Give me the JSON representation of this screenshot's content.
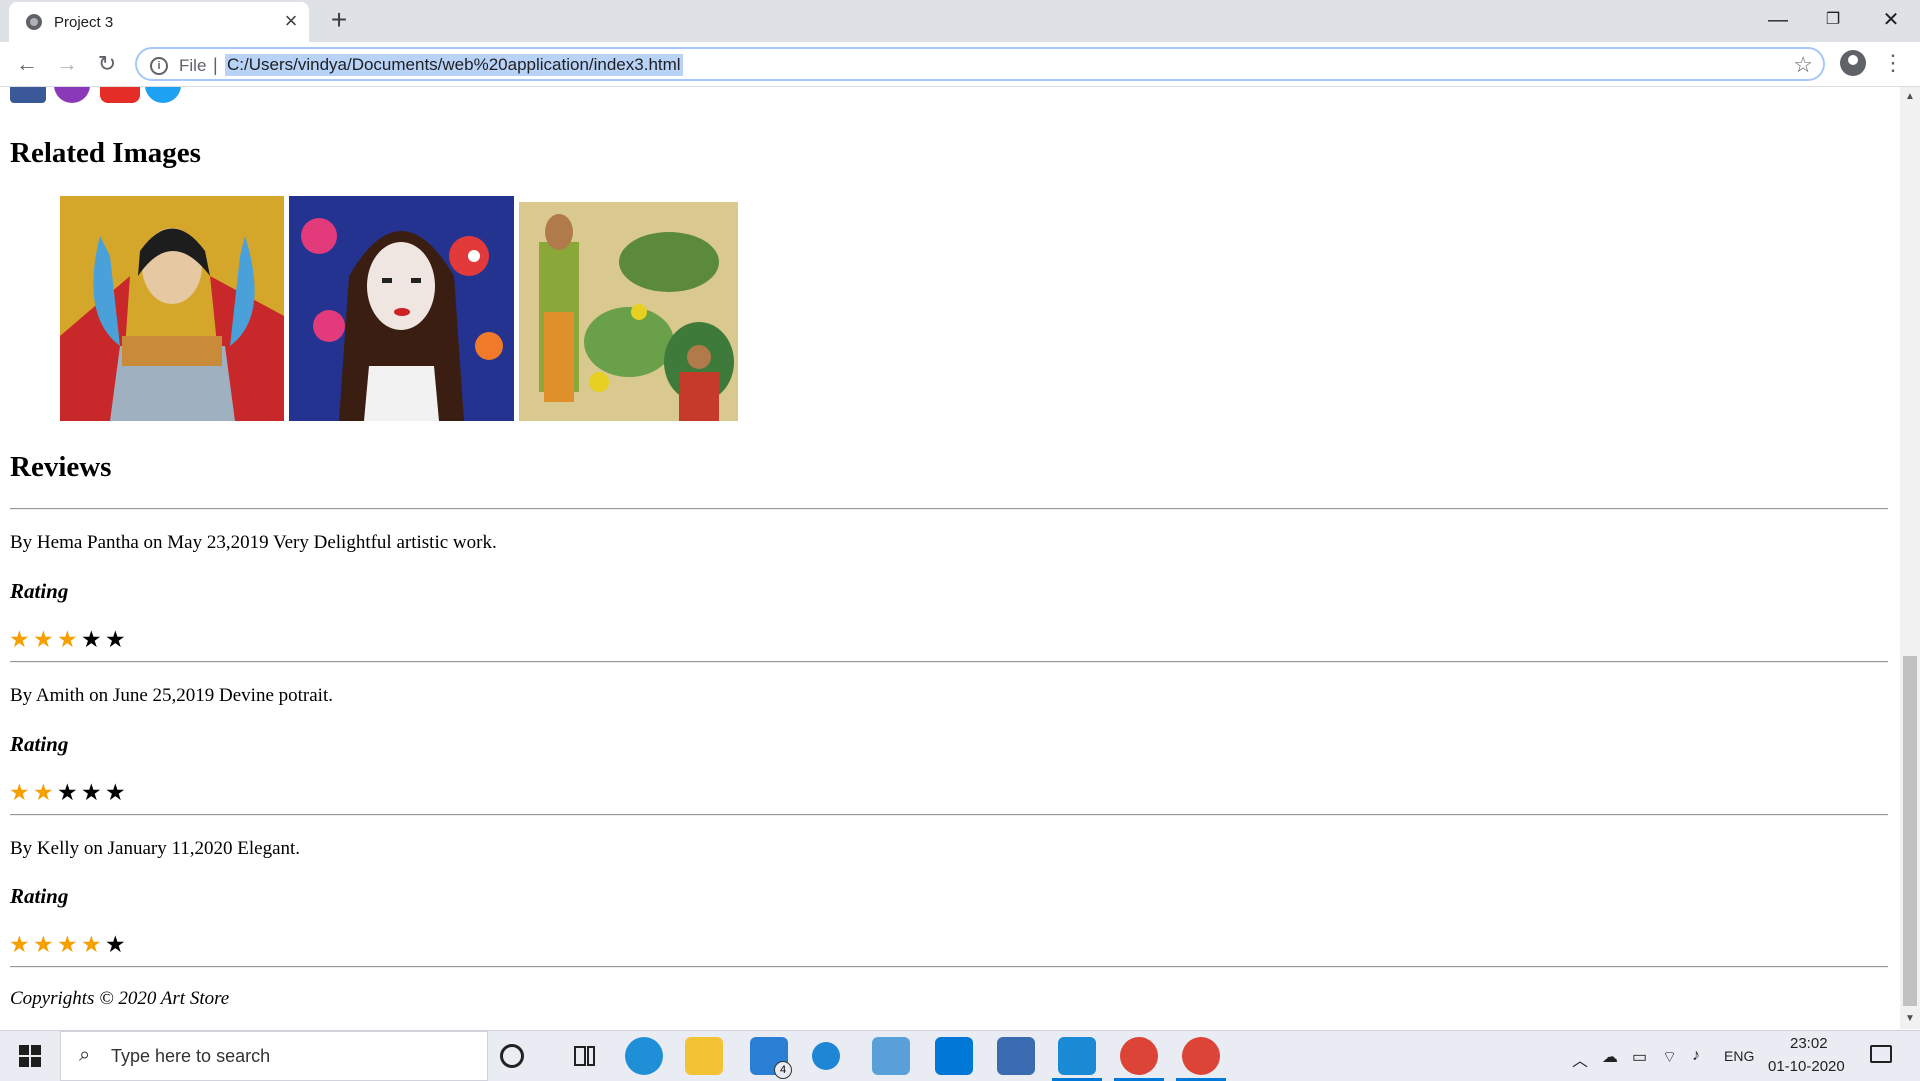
{
  "browser": {
    "tab_title": "Project 3",
    "tab_close_glyph": "×",
    "new_tab_glyph": "+",
    "window_minimize_glyph": "—",
    "window_restore_glyph": "❐",
    "window_close_glyph": "✕",
    "back_glyph": "←",
    "forward_glyph": "→",
    "reload_glyph": "↻",
    "file_label": "File",
    "url": "C:/Users/vindya/Documents/web%20application/index3.html",
    "star_glyph": "☆",
    "menu_glyph": "⋮"
  },
  "page": {
    "related_heading": "Related Images",
    "reviews_heading": "Reviews",
    "reviews": [
      {
        "text": "By Hema Pantha on May 23,2019 Very Delightful artistic work.",
        "rating_label": "Rating",
        "rating": 3,
        "max": 5
      },
      {
        "text": "By Amith on June 25,2019 Devine potrait.",
        "rating_label": "Rating",
        "rating": 2,
        "max": 5
      },
      {
        "text": "By Kelly on January 11,2020 Elegant.",
        "rating_label": "Rating",
        "rating": 4,
        "max": 5
      }
    ],
    "copyright": "Copyrights © 2020 Art Store"
  },
  "taskbar": {
    "search_placeholder": "Type here to search",
    "mail_badge": "4",
    "language": "ENG",
    "time": "23:02",
    "date": "01-10-2020"
  },
  "colors": {
    "star_checked": "#f5a000",
    "star_unchecked": "#000000",
    "url_highlight": "#b9d3f7"
  }
}
